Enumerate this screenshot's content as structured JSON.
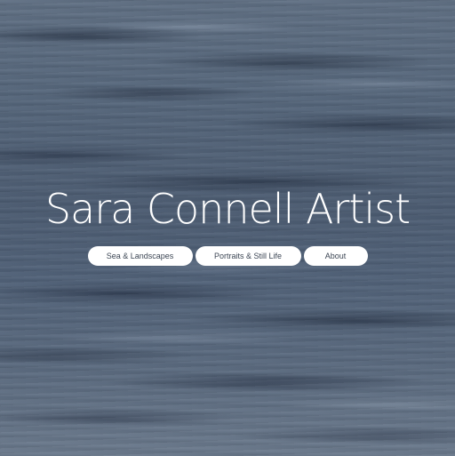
{
  "site": {
    "title": "Sara Connell Artist"
  },
  "nav": {
    "items": [
      {
        "label": "Sea & Landscapes"
      },
      {
        "label": "Portraits & Still Life"
      },
      {
        "label": "About"
      }
    ]
  },
  "background": {
    "description_colors": [
      "#5f6f83",
      "#4c5c72",
      "#6a798c"
    ]
  }
}
